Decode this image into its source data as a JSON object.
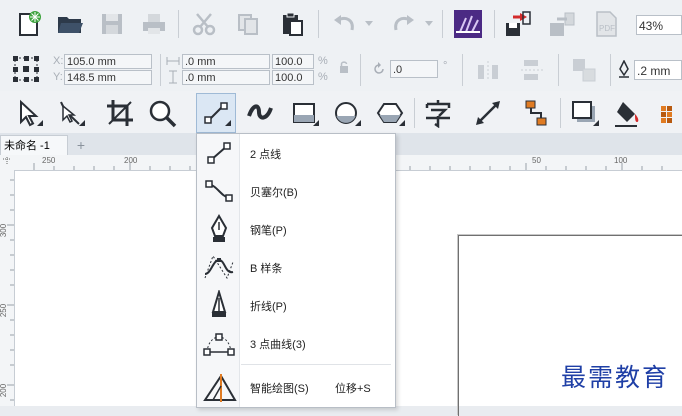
{
  "toolbar": {
    "zoom_value": "43%"
  },
  "property_bar": {
    "x_label": "X:",
    "x_value": "105.0 mm",
    "y_label": "Y:",
    "y_value": "148.5 mm",
    "width_value": ".0 mm",
    "height_value": ".0 mm",
    "scale_x": "100.0",
    "scale_y": "100.0",
    "percent": "%",
    "angle_value": ".0",
    "degree": "°",
    "outline_value": ".2 mm"
  },
  "document_tab": {
    "label": "未命名 -1",
    "add_label": "+"
  },
  "ruler": {
    "h_labels": [
      "250",
      "200",
      "50",
      "100"
    ],
    "v_labels": [
      "300",
      "250",
      "200"
    ]
  },
  "curve_menu": {
    "items": [
      {
        "label": "2 点线",
        "shortcut": ""
      },
      {
        "label": "贝塞尔(B)",
        "shortcut": ""
      },
      {
        "label": "钢笔(P)",
        "shortcut": ""
      },
      {
        "label": "B 样条",
        "shortcut": ""
      },
      {
        "label": "折线(P)",
        "shortcut": ""
      },
      {
        "label": "3 点曲线(3)",
        "shortcut": ""
      },
      {
        "label": "智能绘图(S)",
        "shortcut": "位移+S"
      }
    ]
  },
  "watermark": {
    "text": "最需教育"
  }
}
